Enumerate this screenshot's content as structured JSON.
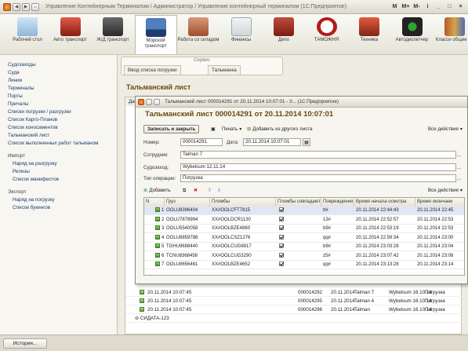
{
  "app": {
    "title": "Управление Контейнерным Терминалом / Администратор / Управление контейнерный терминалом  (1С:Предприятие)",
    "title_buttons": [
      "M",
      "M+",
      "M-",
      "i",
      "_",
      "□",
      "×"
    ]
  },
  "toolbar": {
    "items": [
      {
        "label": "Рабочий стол",
        "icon": "desk-icon",
        "active": false
      },
      {
        "label": "Авто транспорт",
        "icon": "truck-icon",
        "active": false
      },
      {
        "label": "Ж/Д транспорт",
        "icon": "train-icon",
        "active": false
      },
      {
        "label": "Морской транспорт",
        "icon": "ship-icon",
        "active": true
      },
      {
        "label": "Работа со складом",
        "icon": "warehouse-icon",
        "active": false
      },
      {
        "label": "Финансы",
        "icon": "money-icon",
        "active": false
      },
      {
        "label": "Депо",
        "icon": "container-icon",
        "active": false
      },
      {
        "label": "ТАМОЖНЯ",
        "icon": "customs-icon",
        "active": false
      },
      {
        "label": "Техника",
        "icon": "crane-icon",
        "active": false
      },
      {
        "label": "Автодиспетчер",
        "icon": "traffic-light-icon",
        "active": false
      },
      {
        "label": "Класси общие да",
        "icon": "books-icon",
        "active": false
      }
    ]
  },
  "sidebar": {
    "items": [
      "Судозаходы",
      "Суда",
      "Линии",
      "Терминалы",
      "Порты",
      "Причалы",
      "Списки погрузки / разгрузки",
      "Список Карго-Планов",
      "Список коносаментов",
      "Тальманский лист",
      "Список выполненных работ тальманом"
    ],
    "import_title": "Импорт",
    "import_items": [
      "Наряд на разгрузку",
      "Релизы",
      "Список манифестов"
    ],
    "export_title": "Экспорт",
    "export_items": [
      "Наряд на погрузку",
      "Список букингов"
    ]
  },
  "services": {
    "caption": "Сервис",
    "tabs": [
      "Ввод списка погрузки",
      "Тальманка"
    ]
  },
  "main": {
    "title": "Тальманский лист",
    "bg_rows": [
      {
        "date": "20.11.2014 10:07:45",
        "num": "000014292",
        "date2": "20.11.2014",
        "who": "Talman 7",
        "ship": "Wybelsum 16.10.14",
        "op": "Погрузка"
      },
      {
        "date": "20.11.2014 10:07:45",
        "num": "000014295",
        "date2": "20.11.2014",
        "who": "Talman 4",
        "ship": "Wybelsum 16.10.14",
        "op": "Погрузка"
      },
      {
        "date": "20.11.2014 10:07:45",
        "num": "000014296",
        "date2": "20.11.2014",
        "who": "Talman",
        "ship": "Wybelsum 16.10.14",
        "op": "Погрузка"
      }
    ],
    "group_label": "СИДАТА-123"
  },
  "dialog": {
    "window_title": "Тальманский лист 000014291 от 20.11.2014 10:07:01 - У...  (1С:Предприятие)",
    "heading": "Тальманский лист 000014291 от 20.11.2014 10:07:01",
    "save_close": "Записать и закрыть",
    "print": "Печать",
    "add_from": "Добавить из другого листа",
    "all_actions": "Все действия",
    "number_label": "Номер:",
    "number_value": "000014291",
    "date_label": "Дата:",
    "date_value": "20.11.2014 10:07:01",
    "employee_label": "Сотрудник:",
    "employee_value": "Talman 7",
    "ship_label": "Судозаход:",
    "ship_value": "Wybelsum 12.11.14",
    "optype_label": "Тип операции:",
    "optype_value": "Погрузка",
    "add_button": "Добавить",
    "table_actions": "Все действия",
    "columns": [
      "N",
      "Груз",
      "Пломбы",
      "Пломбы совпадают",
      "Повреждения",
      "Время начала осмотра",
      "Время окончани"
    ],
    "rows": [
      {
        "n": "1",
        "cargo": "OOLU8396404",
        "seal": "XX#OOLCFT7815",
        "match": true,
        "damage": "tt#",
        "start": "20.11.2014 22:44:43",
        "end": "20.11.2014 22:45"
      },
      {
        "n": "2",
        "cargo": "OOLU7878994",
        "seal": "XX#OOLDCR1130",
        "match": true,
        "damage": "13#",
        "start": "20.11.2014 22:52:57",
        "end": "20.11.2014 22:53"
      },
      {
        "n": "3",
        "cargo": "OOLU5540058",
        "seal": "XX#OOLBZE4860",
        "match": true,
        "damage": "b9#",
        "start": "20.11.2014 22:53:19",
        "end": "20.11.2014 22:53"
      },
      {
        "n": "4",
        "cargo": "OOLU8859788",
        "seal": "XX#OOLCSZ1276",
        "match": true,
        "damage": "qq#",
        "start": "20.11.2014 22:59:34",
        "end": "20.11.2014 23:00"
      },
      {
        "n": "5",
        "cargo": "TGHU9698440",
        "seal": "XX#OOLCUG6917",
        "match": true,
        "damage": "b9#",
        "start": "20.11.2014 23:03:28",
        "end": "20.11.2014 23:04"
      },
      {
        "n": "6",
        "cargo": "TCNU8368458",
        "seal": "XX#OOLCUG3290",
        "match": true,
        "damage": "z5#",
        "start": "20.11.2014 23:07:42",
        "end": "20.11.2014 23:08"
      },
      {
        "n": "7",
        "cargo": "OOLU8656461",
        "seal": "XX#OOLBZE4652",
        "match": true,
        "damage": "qq#",
        "start": "20.11.2014 23:13:28",
        "end": "20.11.2014 23:14"
      }
    ]
  },
  "taskbar": {
    "history": "История..."
  }
}
